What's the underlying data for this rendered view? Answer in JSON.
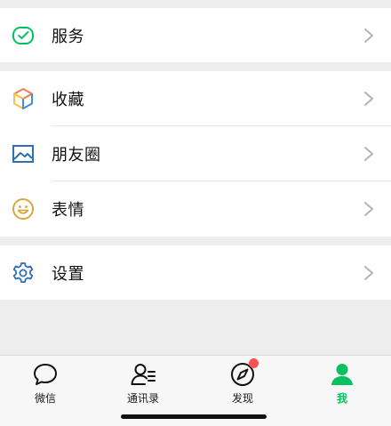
{
  "menu": {
    "services": {
      "label": "服务",
      "icon": "wechat-pay-icon",
      "color": "#07c160"
    },
    "favorites": {
      "label": "收藏",
      "icon": "cube-icon"
    },
    "moments": {
      "label": "朋友圈",
      "icon": "image-icon",
      "color": "#2e6fb5"
    },
    "stickers": {
      "label": "表情",
      "icon": "smiley-icon",
      "color": "#d9a63e"
    },
    "settings": {
      "label": "设置",
      "icon": "gear-icon",
      "color": "#2e6fb5"
    }
  },
  "tabbar": {
    "tabs": [
      {
        "label": "微信",
        "icon": "chat-bubble-icon",
        "active": false
      },
      {
        "label": "通讯录",
        "icon": "contacts-icon",
        "active": false
      },
      {
        "label": "发现",
        "icon": "compass-icon",
        "active": false,
        "badge": true
      },
      {
        "label": "我",
        "icon": "person-icon",
        "active": true
      }
    ],
    "active_color": "#07c160",
    "badge_color": "#fa5151"
  }
}
